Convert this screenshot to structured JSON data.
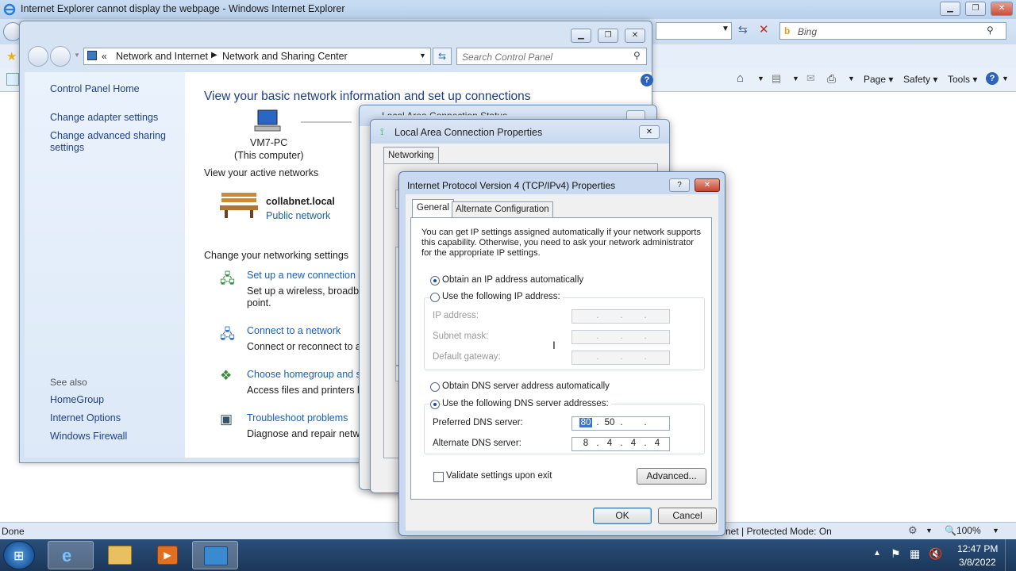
{
  "ie": {
    "title": "Internet Explorer cannot display the webpage - Windows Internet Explorer",
    "search_placeholder": "Bing",
    "cmd": {
      "page": "Page",
      "safety": "Safety",
      "tools": "Tools"
    },
    "status_left": "Done",
    "status_mode": "net | Protected Mode: On",
    "zoom": "100%"
  },
  "cp": {
    "breadcrumb": [
      "«",
      "Network and Internet",
      "Network and Sharing Center"
    ],
    "search_placeholder": "Search Control Panel",
    "sidebar": {
      "home": "Control Panel Home",
      "links": [
        "Change adapter settings",
        "Change advanced sharing settings"
      ],
      "see_also_heading": "See also",
      "see_also": [
        "HomeGroup",
        "Internet Options",
        "Windows Firewall"
      ]
    },
    "main": {
      "heading": "View your basic network information and set up connections",
      "computer_name": "VM7-PC",
      "computer_sub": "(This computer)",
      "active_networks": "View your active networks",
      "network_name": "collabnet.local",
      "network_type": "Public network",
      "change_settings": "Change your networking settings",
      "tasks": [
        {
          "title": "Set up a new connection o",
          "desc": "Set up a wireless, broadban",
          "desc2": "point."
        },
        {
          "title": "Connect to a network",
          "desc": "Connect or reconnect to a",
          "desc2": ""
        },
        {
          "title": "Choose homegroup and sh",
          "desc": "Access files and printers loc",
          "desc2": ""
        },
        {
          "title": "Troubleshoot problems",
          "desc": "Diagnose and repair netwo",
          "desc2": ""
        }
      ]
    }
  },
  "lac_status": {
    "title": "Local Area Connection Status"
  },
  "lac": {
    "title": "Local Area Connection Properties",
    "tab": "Networking"
  },
  "ipv4": {
    "title": "Internet Protocol Version 4 (TCP/IPv4) Properties",
    "tabs": [
      "General",
      "Alternate Configuration"
    ],
    "intro": "You can get IP settings assigned automatically if your network supports this capability. Otherwise, you need to ask your network administrator for the appropriate IP settings.",
    "ip_auto": "Obtain an IP address automatically",
    "ip_manual": "Use the following IP address:",
    "ip_address_label": "IP address:",
    "subnet_label": "Subnet mask:",
    "gateway_label": "Default gateway:",
    "dns_auto": "Obtain DNS server address automatically",
    "dns_manual": "Use the following DNS server addresses:",
    "preferred_label": "Preferred DNS server:",
    "alternate_label": "Alternate DNS server:",
    "preferred_dns": [
      "80",
      "50",
      "",
      ""
    ],
    "alternate_dns": [
      "8",
      "4",
      "4",
      "4"
    ],
    "validate": "Validate settings upon exit",
    "advanced": "Advanced...",
    "ok": "OK",
    "cancel": "Cancel",
    "help_glyph": "?"
  },
  "taskbar": {
    "time": "12:47 PM",
    "date": "3/8/2022"
  }
}
